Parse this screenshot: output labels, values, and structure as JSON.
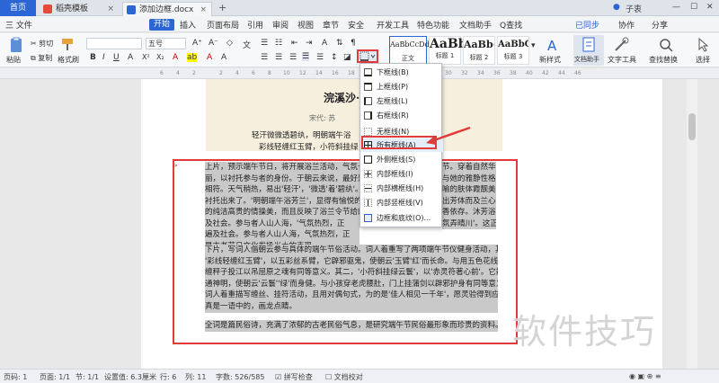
{
  "tabs": {
    "home": "首页",
    "tab1": "稻壳模板",
    "tab2": "添加边框.docx",
    "plus": "+"
  },
  "window": {
    "login": "已同步",
    "user": "子衷"
  },
  "menu": {
    "file": "三 文件",
    "items": [
      "开始",
      "插入",
      "页面布局",
      "引用",
      "审阅",
      "视图",
      "章节",
      "安全",
      "开发工具",
      "特色功能",
      "文档助手",
      "Q查找"
    ],
    "right": [
      "已同步",
      "协作",
      "分享"
    ]
  },
  "ribbon": {
    "paste": "粘贴",
    "cut": "剪切",
    "copy": "复制",
    "format_painter": "格式刷",
    "font_size": "五号",
    "styles": [
      {
        "preview": "AaBbCcDd",
        "label": "正文"
      },
      {
        "preview": "AaBb",
        "label": "标题 1"
      },
      {
        "preview": "AaBb(",
        "label": "标题 2"
      },
      {
        "preview": "AaBbC",
        "label": "标题 3"
      }
    ],
    "new_style": "新样式",
    "doc_assistant": "文档助手",
    "text_tools": "文字工具",
    "find_replace": "查找替换",
    "select": "选择"
  },
  "ruler": [
    "6",
    "4",
    "2",
    "2",
    "4",
    "6",
    "8",
    "10",
    "12",
    "14",
    "16",
    "18",
    "20",
    "22",
    "24",
    "26",
    "28",
    "30",
    "32",
    "34",
    "36",
    "38",
    "40",
    "42",
    "44",
    "46"
  ],
  "document": {
    "title": "浣溪沙·",
    "author": "宋代: 苏",
    "verse1": "轻汗微微透碧纨，明朝端午浴",
    "verse2": "彩线轻缠红玉臂，小符斜挂绿",
    "para1": [
      "上片，预示端午节日，将开展浴兰活动，气氛十分",
      "丽，以衬托参与者的身份。于朝云来说，最好是",
      "相符。天气稍热，易出'轻汗'，'微透'着'碧纨'。",
      "衬托出来了。'明朝端午浴芳兰'，显得有愉悦的",
      "的纯洁高贵的情操美，而且反映了浴兰令节给的",
      "及社会。参与者人山人海，'气氛热烈，正",
      "遍及社会。参与者人山人海，气氛热烈，正",
      "是古老节日文化发扬光大的表现。"
    ],
    "para1_right": [
      "节。穿着自然华",
      "与她的雅静性格",
      "喻的肤体霞靓美",
      "出芳体而及兰心",
      "香依存。沐芳浴",
      "氛弄晴川'。这正"
    ],
    "para2": [
      "下片，写词人偕朝云参与具体的端午节俗活动。词人着重写了两项端午节仪健身活动，其一，",
      "'彩线轻缠红玉臂'，以五彩丝系臂，它辟邪驱鬼，使朝云'玉臂'红'而长命。与用五色花线",
      "缠秤子投江以吊屈原之魂有同等意义。其二，'小符斜挂绿云鬟'，以'赤灵符著心前'。它能",
      "通神明，使朝云'云鬟''绿'而身健。与小孩穿老虎腰肚，门上挂蒲剑以辟邪护身有同等意义。",
      "词人着重描写缠丝、挂符活动，且用对偶句式，为的是'佳人相见一千年'，愿灵验得到应证。",
      "真是一语中的，画龙点睛。"
    ],
    "para3": "全词是篇民俗诗，充满了浓郁的古老民俗气息，是研究端午节民俗最形象而珍贵的资料。"
  },
  "border_menu": [
    "下框线(B)",
    "上框线(P)",
    "左框线(L)",
    "右框线(R)",
    "无框线(N)",
    "所有框线(A)",
    "外侧框线(S)",
    "内部框线(I)",
    "内部横框线(H)",
    "内部竖框线(V)",
    "边框和底纹(O)..."
  ],
  "status": {
    "page": "页码: 1",
    "pages": "页面: 1/1",
    "section": "节: 1/1",
    "setting": "设置值: 6.3厘米",
    "line": "行: 6",
    "col": "列: 11",
    "words": "字数: 526/585",
    "spell": "拼写检查",
    "proof": "文档校对"
  },
  "watermark": "软件技巧",
  "colors": {
    "accent": "#2c66d6",
    "highlight": "#e23b3b",
    "selection": "#c9c9c9"
  }
}
